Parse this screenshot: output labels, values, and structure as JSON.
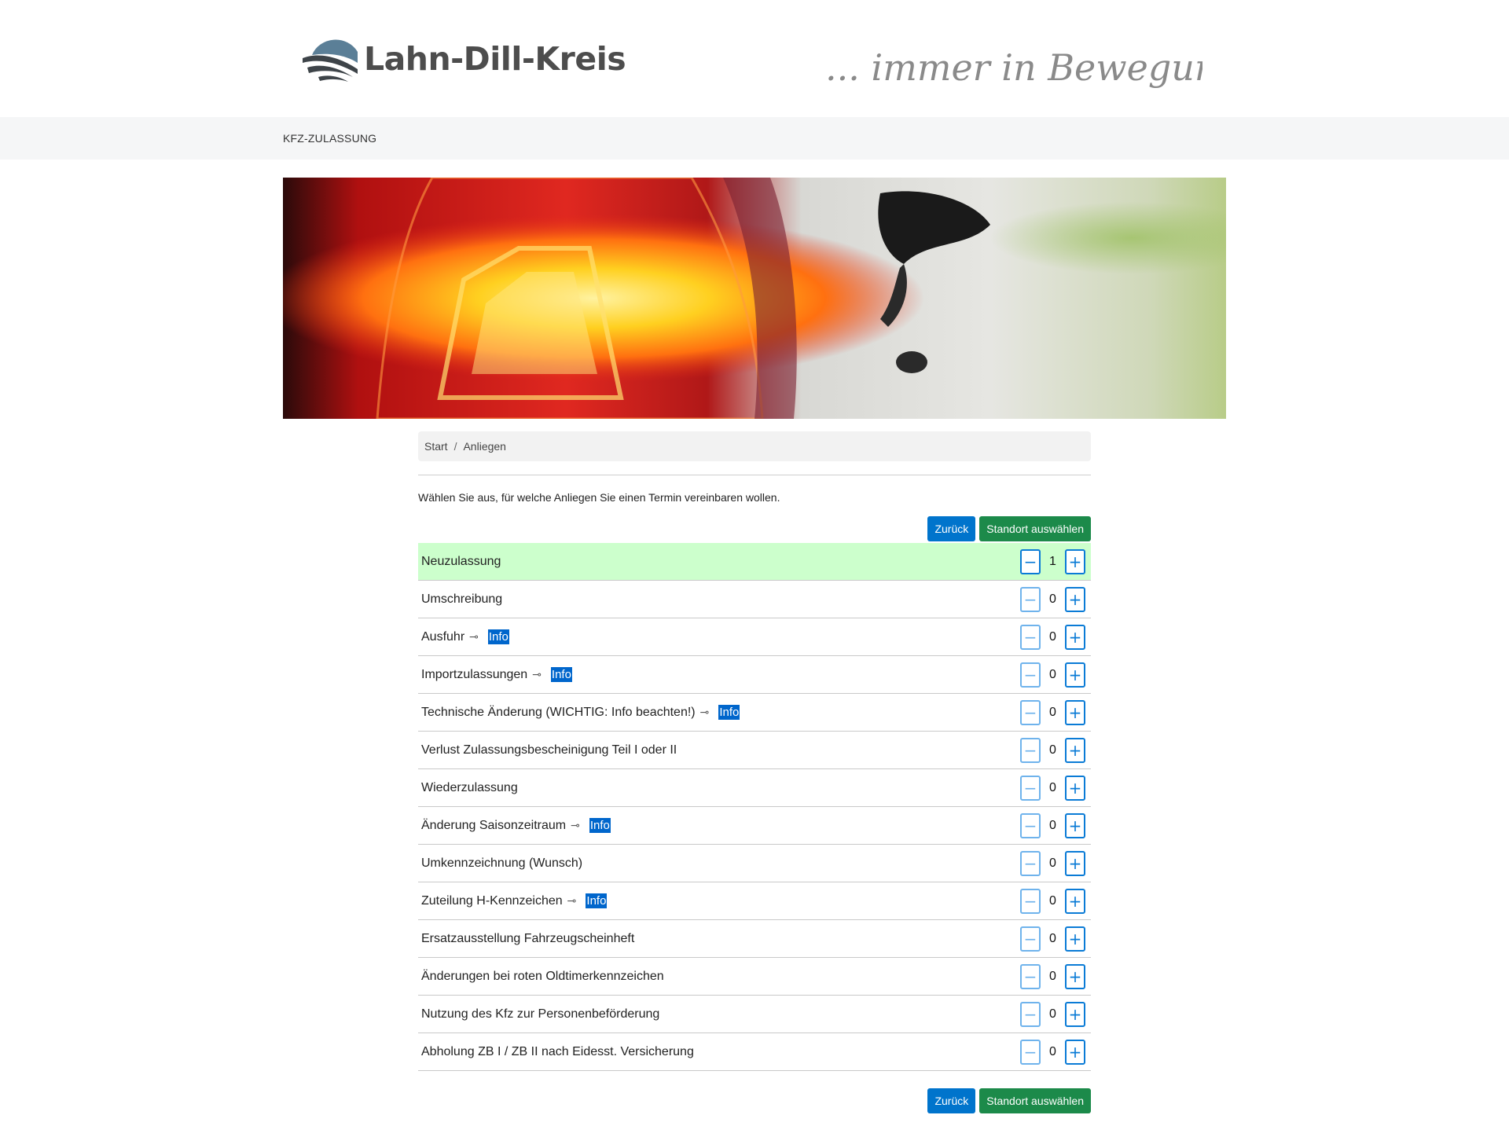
{
  "header": {
    "logo_text": "Lahn-Dill-Kreis",
    "slogan": "... immer in Bewegung!"
  },
  "nav": {
    "link": "KFZ-ZULASSUNG"
  },
  "breadcrumb": {
    "start": "Start",
    "separator": "/",
    "current": "Anliegen"
  },
  "intro_text": "Wählen Sie aus, für welche Anliegen Sie einen Termin vereinbaren wollen.",
  "buttons": {
    "back": "Zurück",
    "next": "Standort auswählen"
  },
  "stepper": {
    "minus": "−",
    "plus": "+"
  },
  "info_label": "Info",
  "arrow_glyph": "⊸",
  "services": [
    {
      "label": "Neuzulassung",
      "count": "1",
      "selected": true,
      "info": false
    },
    {
      "label": "Umschreibung",
      "count": "0",
      "selected": false,
      "info": false
    },
    {
      "label": "Ausfuhr",
      "count": "0",
      "selected": false,
      "info": true
    },
    {
      "label": "Importzulassungen",
      "count": "0",
      "selected": false,
      "info": true
    },
    {
      "label": "Technische Änderung (WICHTIG: Info beachten!)",
      "count": "0",
      "selected": false,
      "info": true
    },
    {
      "label": "Verlust Zulassungsbescheinigung Teil I oder II",
      "count": "0",
      "selected": false,
      "info": false
    },
    {
      "label": "Wiederzulassung",
      "count": "0",
      "selected": false,
      "info": false
    },
    {
      "label": "Änderung Saisonzeitraum",
      "count": "0",
      "selected": false,
      "info": true
    },
    {
      "label": "Umkennzeichnung (Wunsch)",
      "count": "0",
      "selected": false,
      "info": false
    },
    {
      "label": "Zuteilung H-Kennzeichen",
      "count": "0",
      "selected": false,
      "info": true
    },
    {
      "label": "Ersatzausstellung Fahrzeugscheinheft",
      "count": "0",
      "selected": false,
      "info": false
    },
    {
      "label": "Änderungen bei roten Oldtimerkennzeichen",
      "count": "0",
      "selected": false,
      "info": false
    },
    {
      "label": "Nutzung des Kfz zur Personenbeförderung",
      "count": "0",
      "selected": false,
      "info": false
    },
    {
      "label": "Abholung ZB I / ZB II nach Eidesst. Versicherung",
      "count": "0",
      "selected": false,
      "info": false
    }
  ],
  "colors": {
    "primary": "#0074cc",
    "success": "#1c8a4a",
    "selected_row": "#ccffcc",
    "info_badge": "#0066cc",
    "logo_blue": "#5b7f97"
  }
}
